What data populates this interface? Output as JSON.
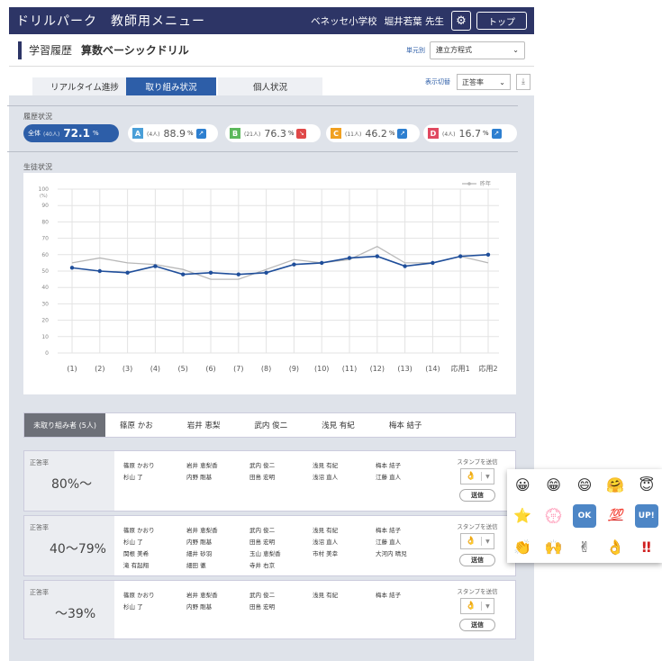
{
  "topbar": {
    "app_title": "ドリルパーク　教師用メニュー",
    "school": "ベネッセ小学校",
    "teacher": "堀井若葉 先生",
    "top_button": "トップ",
    "settings_icon": "gear-icon"
  },
  "header": {
    "history_label": "学習履歴",
    "drill_name": "算数ベーシックドリル",
    "unit_label": "単元別",
    "unit_value": "連立方程式"
  },
  "tabs": [
    {
      "label": "リアルタイム進捗"
    },
    {
      "label": "取り組み状況"
    },
    {
      "label": "個人状況"
    }
  ],
  "display": {
    "label": "表示切替",
    "value": "正答率"
  },
  "sections": {
    "history": "履歴状況",
    "students": "生徒状況"
  },
  "groups": [
    {
      "label": "全体",
      "count": "(40人)",
      "value": "72.1",
      "unit": "%",
      "color": "#2d5ea8"
    },
    {
      "label": "A",
      "count": "(4人)",
      "value": "88.9",
      "unit": "%",
      "color": "#4a9fd8",
      "icon_color": "#2d7fd0"
    },
    {
      "label": "B",
      "count": "(21人)",
      "value": "76.3",
      "unit": "%",
      "color": "#5cb85c",
      "icon_color": "#e04848"
    },
    {
      "label": "C",
      "count": "(11人)",
      "value": "46.2",
      "unit": "%",
      "color": "#f0a020",
      "icon_color": "#2d7fd0"
    },
    {
      "label": "D",
      "count": "(4人)",
      "value": "16.7",
      "unit": "%",
      "color": "#e04860",
      "icon_color": "#2d7fd0"
    }
  ],
  "chart_data": {
    "type": "line",
    "categories": [
      "(1)",
      "(2)",
      "(3)",
      "(4)",
      "(5)",
      "(6)",
      "(7)",
      "(8)",
      "(9)",
      "(10)",
      "(11)",
      "(12)",
      "(13)",
      "(14)",
      "応用1",
      "応用2"
    ],
    "series": [
      {
        "name": "",
        "color": "#1f4e9a",
        "values": [
          52,
          50,
          49,
          53,
          48,
          49,
          48,
          49,
          54,
          55,
          58,
          59,
          53,
          55,
          59,
          60
        ]
      },
      {
        "name": "昨年",
        "color": "#b8b8b8",
        "values": [
          55,
          58,
          55,
          54,
          51,
          45,
          45,
          51,
          57,
          55,
          57,
          65,
          55,
          55,
          59,
          55
        ]
      }
    ],
    "ylabel": "(%)",
    "ylim": [
      0,
      100
    ],
    "yticks": [
      "100",
      "90",
      "80",
      "70",
      "60",
      "50",
      "40",
      "30",
      "20",
      "10",
      "0"
    ],
    "legend": "top-right",
    "grid": true
  },
  "student_tabs": {
    "first": "未取り組み者 (5人)",
    "names": [
      "篠原 かお",
      "岩井 恵梨",
      "武内 俊二",
      "浅見 有紀",
      "梅本 結子"
    ]
  },
  "bands": [
    {
      "label": "正答率",
      "range": "80%〜",
      "names": [
        "篠原 かおり",
        "岩井 恵梨香",
        "武内 俊二",
        "浅見 有紀",
        "梅本 結子",
        "杉山 了",
        "内野 剛基",
        "田島 宏明",
        "浅沼 直人",
        "江藤 直人"
      ]
    },
    {
      "label": "正答率",
      "range": "40〜79%",
      "names": [
        "篠原 かおり",
        "岩井 恵梨香",
        "武内 俊二",
        "浅見 有紀",
        "梅本 結子",
        "杉山 了",
        "内野 剛基",
        "田島 宏明",
        "浅沼 直人",
        "江藤 直人",
        "関根 美希",
        "細井 砂羽",
        "玉山 恵梨香",
        "市村 美幸",
        "大河内 晴児",
        "滝 有起翔",
        "細田 徹",
        "寺井 右京",
        "",
        ""
      ]
    },
    {
      "label": "正答率",
      "range": "〜39%",
      "names": [
        "篠原 かおり",
        "岩井 恵梨香",
        "武内 俊二",
        "浅見 有紀",
        "梅本 結子",
        "杉山 了",
        "内野 剛基",
        "田島 宏明",
        "",
        ""
      ]
    }
  ],
  "stamp": {
    "label": "スタンプを送信",
    "selected": "👌",
    "send": "送信"
  },
  "emoji_palette": [
    "😀",
    "😁",
    "😄",
    "🤗",
    "😇",
    "⭐",
    "💮",
    "OK",
    "💯",
    "UP!",
    "👏",
    "🙌",
    "✌",
    "👌",
    "‼"
  ]
}
